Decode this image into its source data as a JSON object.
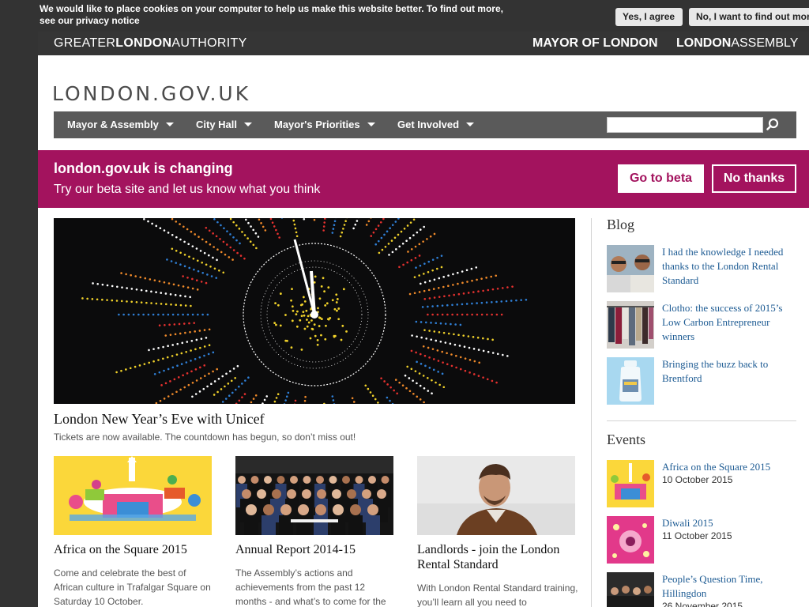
{
  "cookie": {
    "message_line1": "We would like to place cookies on your computer to help us make this website better. To find out more,",
    "message_line2": "see our privacy notice",
    "agree_label": "Yes, I agree",
    "decline_label": "No, I want to find out more"
  },
  "gla_header": {
    "logo_part1": "GREATER",
    "logo_part2": "LONDON",
    "logo_part3": "AUTHORITY",
    "mayor_link": "MAYOR OF LONDON",
    "assembly_part1": "LONDON",
    "assembly_part2": "ASSEMBLY"
  },
  "site": {
    "logo": "LONDON.GOV.UK"
  },
  "nav": {
    "items": [
      {
        "label": "Mayor & Assembly"
      },
      {
        "label": "City Hall"
      },
      {
        "label": "Mayor's Priorities"
      },
      {
        "label": "Get Involved"
      }
    ],
    "search_value": ""
  },
  "beta_banner": {
    "title": "london.gov.uk is changing",
    "subtitle": "Try our beta site and let us know what you think",
    "go_label": "Go to beta",
    "no_label": "No thanks"
  },
  "hero": {
    "title": "London New Year’s Eve with Unicef",
    "description": "Tickets are now available. The countdown has begun, so don’t miss out!"
  },
  "cards": [
    {
      "title": "Africa on the Square 2015",
      "description": "Come and celebrate the best of African culture in Trafalgar Square on Saturday 10 October."
    },
    {
      "title": "Annual Report 2014-15",
      "description": "The Assembly’s actions and achievements from the past 12 months - and what’s to come for the"
    },
    {
      "title": "Landlords - join the London Rental Standard",
      "description": "With London Rental Standard training, you’ll learn all you need to"
    }
  ],
  "blog": {
    "heading": "Blog",
    "items": [
      {
        "title": "I had the knowledge I needed thanks to the London Rental Standard"
      },
      {
        "title": "Clotho: the success of 2015’s Low Carbon Entrepreneur winners"
      },
      {
        "title": "Bringing the buzz back to Brentford"
      }
    ]
  },
  "events": {
    "heading": "Events",
    "items": [
      {
        "title": "Africa on the Square 2015",
        "date": "10 October 2015"
      },
      {
        "title": "Diwali 2015",
        "date": "11 October 2015"
      },
      {
        "title": "People’s Question Time, Hillingdon",
        "date": "26 November 2015"
      }
    ]
  },
  "colors": {
    "brand_magenta": "#a3135e",
    "nav_grey": "#5a5a5a",
    "link_blue": "#1d5b93",
    "dark_bar": "#333333"
  }
}
